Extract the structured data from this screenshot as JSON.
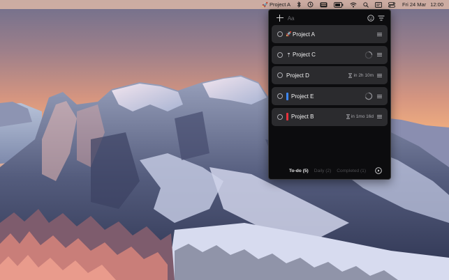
{
  "menubar": {
    "app_label": "Project A",
    "app_emoji": "🚀",
    "date": "Fri 24 Mar",
    "time": "12:00",
    "status_icons": [
      "bluetooth-icon",
      "time-machine-icon",
      "keyboard-input-icon",
      "battery-icon",
      "wifi-icon",
      "spotlight-search-icon",
      "screen-mirror-icon",
      "control-center-icon"
    ]
  },
  "panel": {
    "add_placeholder": "Aa",
    "tasks": [
      {
        "title": "Project A",
        "marker": "🚀",
        "marker_type": "emoji",
        "due": "",
        "progress_spinner": false
      },
      {
        "title": "Project C",
        "marker": "🔨",
        "marker_type": "emoji",
        "due": "",
        "progress_spinner": true
      },
      {
        "title": "Project D",
        "marker": "",
        "marker_type": "none",
        "due": "in 2h 10m",
        "progress_spinner": false
      },
      {
        "title": "Project E",
        "marker": "",
        "marker_type": "color",
        "color": "#3d87f5",
        "due": "",
        "progress_spinner": true
      },
      {
        "title": "Project B",
        "marker": "",
        "marker_type": "color",
        "color": "#e8323c",
        "due": "in 1mo 16d",
        "progress_spinner": false
      }
    ],
    "tabs": [
      {
        "label": "To-do (5)",
        "active": true
      },
      {
        "label": "Daily (2)",
        "active": false
      },
      {
        "label": "Completed (1)",
        "active": false
      }
    ]
  },
  "colors": {
    "panel_bg": "#0c0c0e",
    "row_bg": "#2b2b2e",
    "accent_blue": "#3d87f5",
    "accent_red": "#e8323c"
  }
}
